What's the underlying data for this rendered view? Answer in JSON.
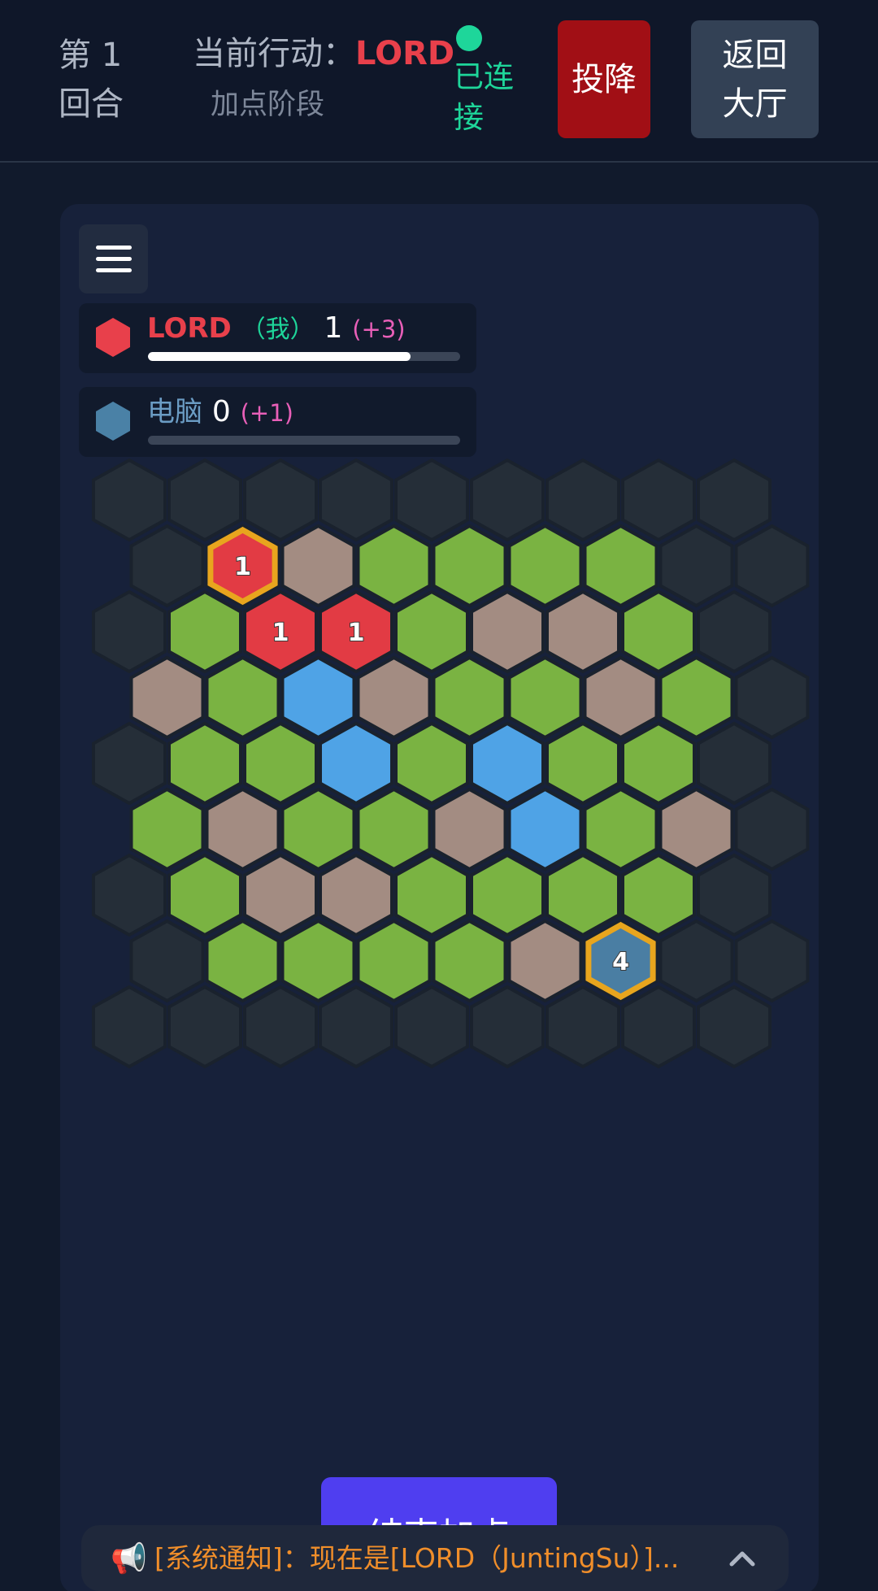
{
  "header": {
    "round_label": "第 1 回合",
    "current_action_label": "当前行动：",
    "current_player": "LORD",
    "phase": "加点阶段",
    "connection_status": "已连接",
    "surrender_label": "投降",
    "back_to_lobby_label": "返回大厅"
  },
  "players": [
    {
      "name": "LORD",
      "tag": "（我）",
      "score": "1",
      "bonus": "(+3)",
      "progress": 0.84,
      "color": "#e8404b",
      "name_color": "#e8404b"
    },
    {
      "name": "电脑",
      "tag": "",
      "score": "0",
      "bonus": "(+1)",
      "progress": 0,
      "color": "#4a81a6",
      "name_color": "#6b9cc4"
    }
  ],
  "board": {
    "cols": 9,
    "rows": 9,
    "colors": {
      "empty": "#252e38",
      "grass": "#7ab342",
      "stone": "#a38c82",
      "water": "#4fa3e6",
      "red": "#e23b44",
      "blue_base": "#4a7ea3",
      "highlight": "#e8a51e"
    },
    "cells": [
      [
        "empty",
        "empty",
        "empty",
        "empty",
        "empty",
        "empty",
        "empty",
        "empty",
        "empty"
      ],
      [
        "empty",
        "red",
        "stone",
        "grass",
        "grass",
        "grass",
        "grass",
        "empty",
        "empty"
      ],
      [
        "empty",
        "grass",
        "red",
        "red",
        "grass",
        "stone",
        "stone",
        "grass",
        "empty"
      ],
      [
        "stone",
        "grass",
        "water",
        "stone",
        "grass",
        "grass",
        "stone",
        "grass",
        "empty"
      ],
      [
        "empty",
        "grass",
        "grass",
        "water",
        "grass",
        "water",
        "grass",
        "grass",
        "empty"
      ],
      [
        "grass",
        "stone",
        "grass",
        "grass",
        "stone",
        "water",
        "grass",
        "stone",
        "empty"
      ],
      [
        "empty",
        "grass",
        "stone",
        "stone",
        "grass",
        "grass",
        "grass",
        "grass",
        "empty"
      ],
      [
        "empty",
        "grass",
        "grass",
        "grass",
        "grass",
        "stone",
        "blue_base",
        "empty",
        "empty"
      ],
      [
        "empty",
        "empty",
        "empty",
        "empty",
        "empty",
        "empty",
        "empty",
        "empty",
        "empty"
      ]
    ],
    "labels": [
      {
        "row": 1,
        "col": 1,
        "text": "1"
      },
      {
        "row": 2,
        "col": 2,
        "text": "1"
      },
      {
        "row": 2,
        "col": 3,
        "text": "1"
      },
      {
        "row": 7,
        "col": 6,
        "text": "4"
      }
    ],
    "highlighted": [
      {
        "row": 1,
        "col": 1
      },
      {
        "row": 7,
        "col": 6
      }
    ]
  },
  "end_button_label": "结束加点",
  "notice": {
    "icon": "megaphone-icon",
    "text": "[系统通知]：现在是[LORD（JuntingSu）]..."
  }
}
